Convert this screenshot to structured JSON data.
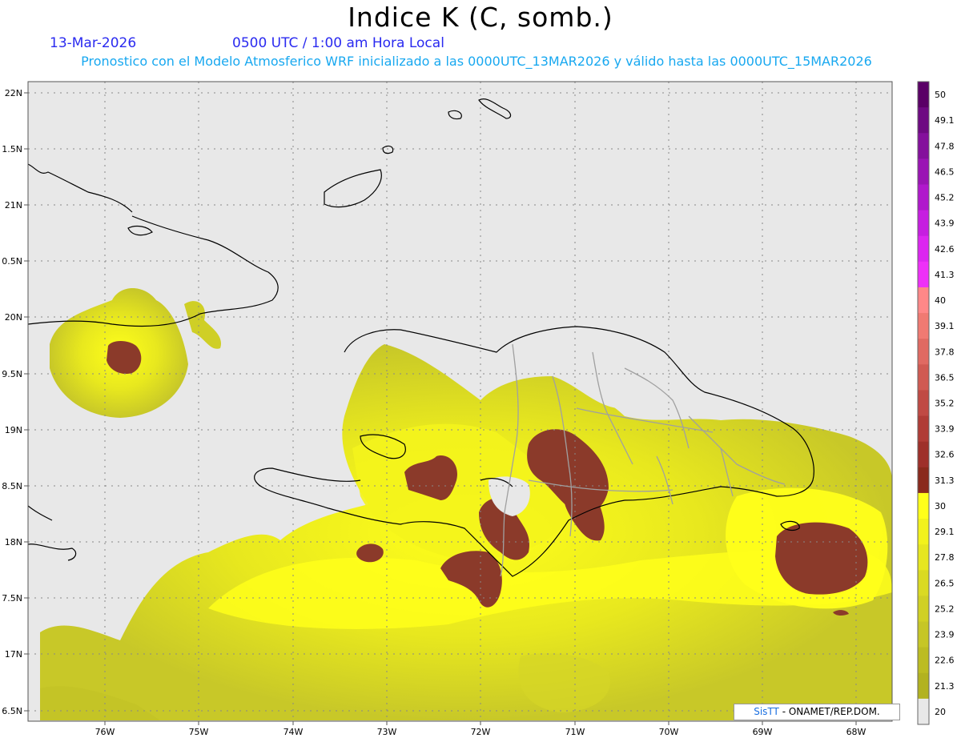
{
  "header": {
    "title": "Indice K (C, somb.)",
    "date": "13-Mar-2026",
    "time": "0500 UTC / 1:00 am Hora Local",
    "subtitle": "Pronostico con el Modelo Atmosferico WRF inicializado a las 0000UTC_13MAR2026 y válido hasta las  0000UTC_15MAR2026"
  },
  "axes": {
    "lat_labels": [
      "22N",
      "1.5N",
      "21N",
      "0.5N",
      "20N",
      "9.5N",
      "19N",
      "8.5N",
      "18N",
      "7.5N",
      "17N",
      "6.5N"
    ],
    "lon_labels": [
      "76W",
      "75W",
      "74W",
      "73W",
      "72W",
      "71W",
      "70W",
      "69W",
      "68W"
    ]
  },
  "colorbar": {
    "labels": [
      "50",
      "49.1",
      "47.8",
      "46.5",
      "45.2",
      "43.9",
      "42.6",
      "41.3",
      "40",
      "39.1",
      "37.8",
      "36.5",
      "35.2",
      "33.9",
      "32.6",
      "31.3",
      "30",
      "29.1",
      "27.8",
      "26.5",
      "25.2",
      "23.9",
      "22.6",
      "21.3",
      "20"
    ],
    "colors": [
      "#5a0066",
      "#6e0a82",
      "#84109c",
      "#9a14b4",
      "#b018cc",
      "#c61ee0",
      "#dc26f0",
      "#ee30f8",
      "#ff8888",
      "#f07a72",
      "#e06a62",
      "#d05a52",
      "#c04a44",
      "#b03c36",
      "#9e302a",
      "#8a2a1c",
      "#ffff1a",
      "#f2f21c",
      "#e6e620",
      "#dada22",
      "#d0d024",
      "#c6c626",
      "#bcbc22",
      "#b2b220",
      "#e8e8e8"
    ]
  },
  "credit": {
    "brand": "SisTT",
    "org": " - ONAMET/REP.DOM."
  },
  "colors": {
    "land_bg": "#e8e8e8",
    "coast": "#000000",
    "borders": "#a0a0a0",
    "high_k": "#8b3a2a",
    "grid": "#888888"
  }
}
